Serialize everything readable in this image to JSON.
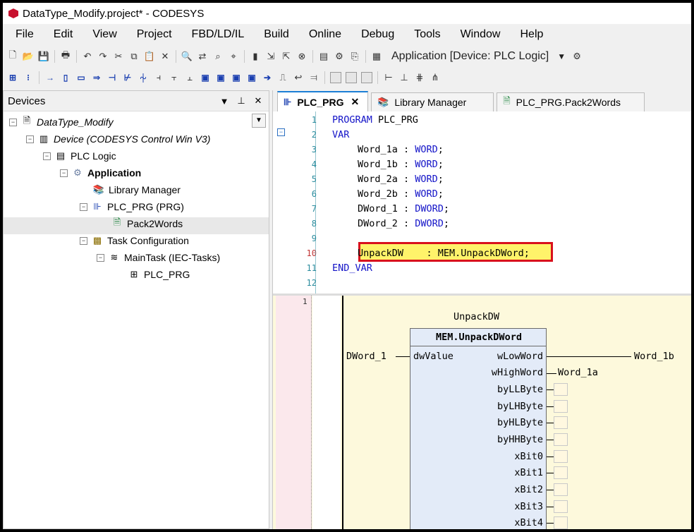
{
  "window": {
    "title": "DataType_Modify.project* - CODESYS"
  },
  "menu": [
    "File",
    "Edit",
    "View",
    "Project",
    "FBD/LD/IL",
    "Build",
    "Online",
    "Debug",
    "Tools",
    "Window",
    "Help"
  ],
  "toolbar": {
    "application_selector": "Application [Device: PLC Logic]"
  },
  "devices_panel": {
    "title": "Devices",
    "tree": [
      {
        "label": "DataType_Modify",
        "icon": "project-icon"
      },
      {
        "label": "Device (CODESYS Control Win V3)",
        "icon": "device-icon"
      },
      {
        "label": "PLC Logic",
        "icon": "plc-logic-icon"
      },
      {
        "label": "Application",
        "icon": "application-gear-icon"
      },
      {
        "label": "Library Manager",
        "icon": "library-books-icon"
      },
      {
        "label": "PLC_PRG (PRG)",
        "icon": "program-icon"
      },
      {
        "label": "Pack2Words",
        "icon": "action-icon"
      },
      {
        "label": "Task Configuration",
        "icon": "task-config-icon"
      },
      {
        "label": "MainTask (IEC-Tasks)",
        "icon": "task-icon"
      },
      {
        "label": "PLC_PRG",
        "icon": "program-call-icon"
      }
    ]
  },
  "editor": {
    "tabs": [
      {
        "label": "PLC_PRG",
        "active": true
      },
      {
        "label": "Library Manager"
      },
      {
        "label": "PLC_PRG.Pack2Words"
      }
    ],
    "declaration": {
      "line_numbers": [
        "1",
        "2",
        "3",
        "4",
        "5",
        "6",
        "7",
        "8",
        "9",
        "10",
        "11",
        "12"
      ],
      "lines": {
        "l1": {
          "kw": "PROGRAM",
          "rest": " PLC_PRG"
        },
        "l2": {
          "kw": "VAR"
        },
        "l3": {
          "name": "Word_1a : ",
          "type": "WORD",
          "end": ";"
        },
        "l4": {
          "name": "Word_1b : ",
          "type": "WORD",
          "end": ";"
        },
        "l5": {
          "name": "Word_2a : ",
          "type": "WORD",
          "end": ";"
        },
        "l6": {
          "name": "Word_2b : ",
          "type": "WORD",
          "end": ";"
        },
        "l7": {
          "name": "DWord_1 : ",
          "type": "DWORD",
          "end": ";"
        },
        "l8": {
          "name": "DWord_2 : ",
          "type": "DWORD",
          "end": ";"
        },
        "l10": {
          "text": "UnpackDW    : MEM.UnpackDWord;"
        },
        "l11": {
          "kw": "END_VAR"
        }
      }
    },
    "fbd": {
      "network_number": "1",
      "instance_name": "UnpackDW",
      "block_type": "MEM.UnpackDWord",
      "input_pin": "dwValue",
      "input_var": "DWord_1",
      "output_pins": [
        "wLowWord",
        "wHighWord",
        "byLLByte",
        "byLHByte",
        "byHLByte",
        "byHHByte",
        "xBit0",
        "xBit1",
        "xBit2",
        "xBit3",
        "xBit4"
      ],
      "output_vars": {
        "wLowWord": "Word_1b",
        "wHighWord": "Word_1a"
      }
    }
  }
}
